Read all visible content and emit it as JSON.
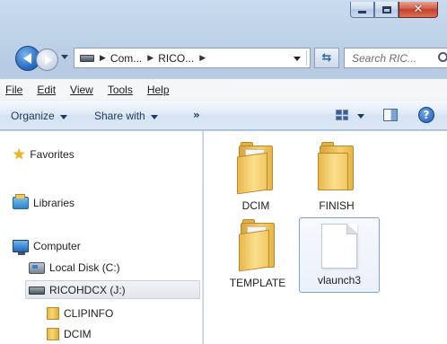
{
  "window": {
    "minimize_icon": "minimize-icon",
    "maximize_icon": "maximize-icon",
    "close_icon": "close-icon"
  },
  "nav": {
    "breadcrumbs": [
      "Com...",
      "RICO..."
    ],
    "search_placeholder": "Search RIC..."
  },
  "menu": {
    "items": [
      "File",
      "Edit",
      "View",
      "Tools",
      "Help"
    ]
  },
  "commands": {
    "organize": "Organize",
    "share": "Share with",
    "more": "»"
  },
  "navpane": {
    "favorites": "Favorites",
    "libraries": "Libraries",
    "computer": "Computer",
    "local_disk": "Local Disk (C:)",
    "ricoh": "RICOHDCX (J:)",
    "clipinfo": "CLIPINFO",
    "dcim": "DCIM"
  },
  "files": [
    {
      "name": "DCIM",
      "type": "folder"
    },
    {
      "name": "FINISH",
      "type": "folder"
    },
    {
      "name": "TEMPLATE",
      "type": "folder"
    },
    {
      "name": "vlaunch3",
      "type": "file",
      "selected": true
    }
  ],
  "colors": {
    "frame": "#c3d6ec",
    "selection_border": "#7da2ce",
    "folder_yellow": "#f3cf6d"
  }
}
